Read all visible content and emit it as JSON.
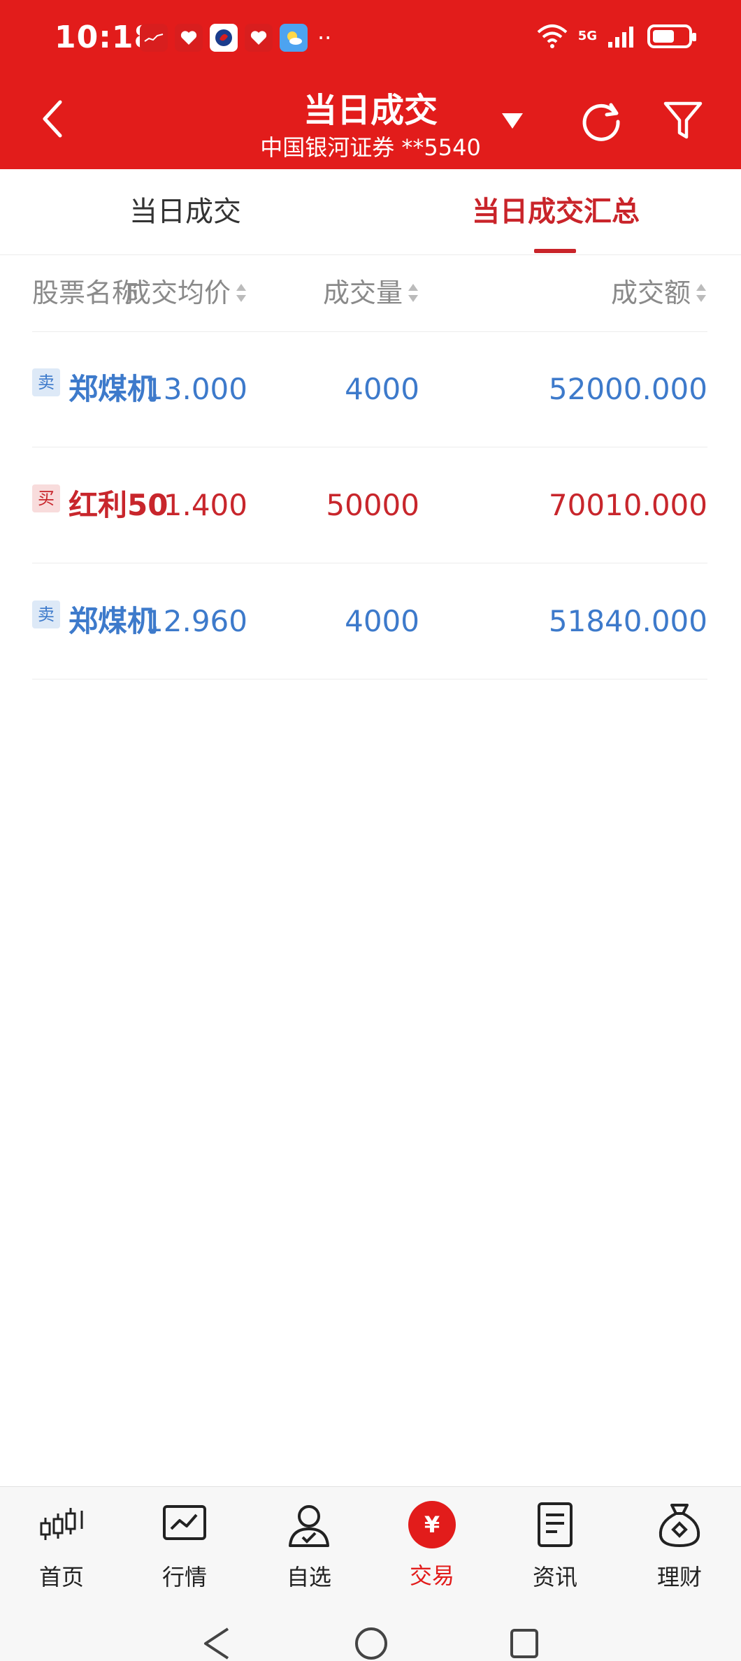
{
  "status_bar": {
    "time": "10:18",
    "network": "5G"
  },
  "header": {
    "title": "当日成交",
    "subtitle": "中国银河证券 **5540"
  },
  "tabs": [
    {
      "label": "当日成交",
      "active": false
    },
    {
      "label": "当日成交汇总",
      "active": true
    }
  ],
  "table": {
    "columns": [
      "股票名称",
      "成交均价",
      "成交量",
      "成交额"
    ],
    "rows": [
      {
        "type": "sell",
        "badge": "卖",
        "name": "郑煤机",
        "price": "13.000",
        "qty": "4000",
        "amount": "52000.000"
      },
      {
        "type": "buy",
        "badge": "买",
        "name": "红利50",
        "price": "1.400",
        "qty": "50000",
        "amount": "70010.000"
      },
      {
        "type": "sell",
        "badge": "卖",
        "name": "郑煤机",
        "price": "12.960",
        "qty": "4000",
        "amount": "51840.000"
      }
    ]
  },
  "bottom_nav": [
    {
      "label": "首页",
      "icon": "candlestick-icon"
    },
    {
      "label": "行情",
      "icon": "chart-icon"
    },
    {
      "label": "自选",
      "icon": "user-check-icon"
    },
    {
      "label": "交易",
      "icon": "yuan-icon",
      "active": true,
      "glyph": "¥"
    },
    {
      "label": "资讯",
      "icon": "document-icon"
    },
    {
      "label": "理财",
      "icon": "money-bag-icon"
    }
  ],
  "colors": {
    "brand_red": "#e21c1b",
    "sell_blue": "#3d7acb",
    "buy_red": "#c8262c"
  }
}
